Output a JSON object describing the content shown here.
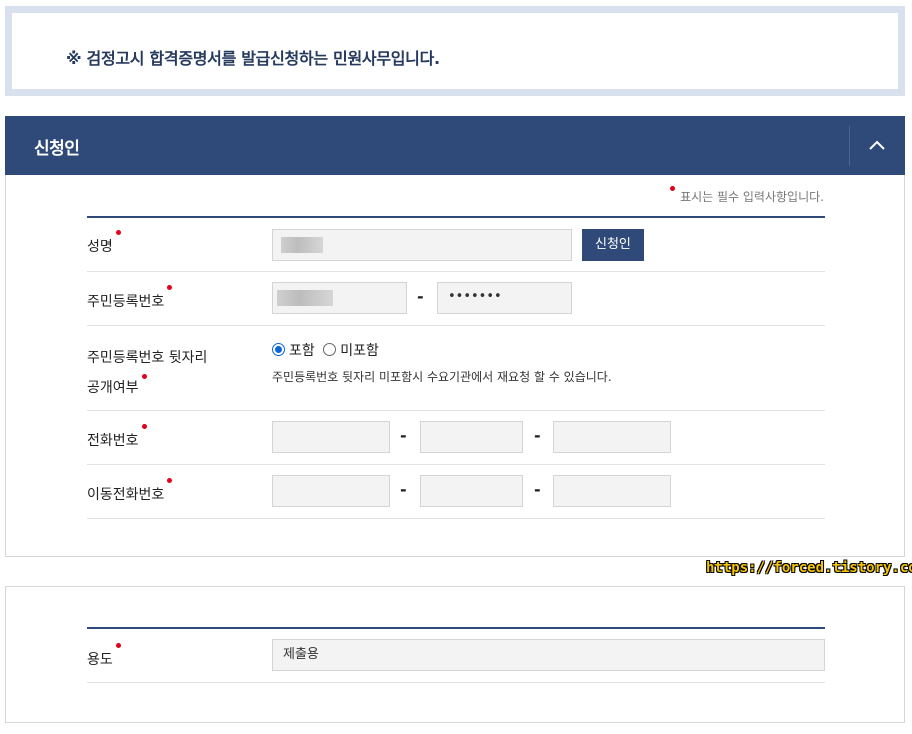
{
  "notice": {
    "text": "※ 검정고시 합격증명서를 발급신청하는 민원사무입니다."
  },
  "section": {
    "title": "신청인"
  },
  "required_note": "표시는 필수 입력사항입니다.",
  "fields": {
    "name": {
      "label": "성명",
      "button": "신청인"
    },
    "rrn": {
      "label": "주민등록번호",
      "back_value": "•••••••",
      "dash": "-"
    },
    "rrn_disclose": {
      "label_line1": "주민등록번호 뒷자리",
      "label_line2": "공개여부",
      "options": [
        "포함",
        "미포함"
      ],
      "selected": "포함",
      "hint": "주민등록번호 뒷자리 미포함시 수요기관에서 재요청 할 수 있습니다."
    },
    "phone": {
      "label": "전화번호",
      "dash": "-"
    },
    "mobile": {
      "label": "이동전화번호",
      "dash": "-"
    },
    "purpose": {
      "label": "용도",
      "value": "제출용"
    }
  },
  "watermark": "https://forced.tistory.com",
  "colors": {
    "primary": "#2f4a78",
    "required": "#e0001b",
    "notice_border": "#d9e1ef"
  }
}
